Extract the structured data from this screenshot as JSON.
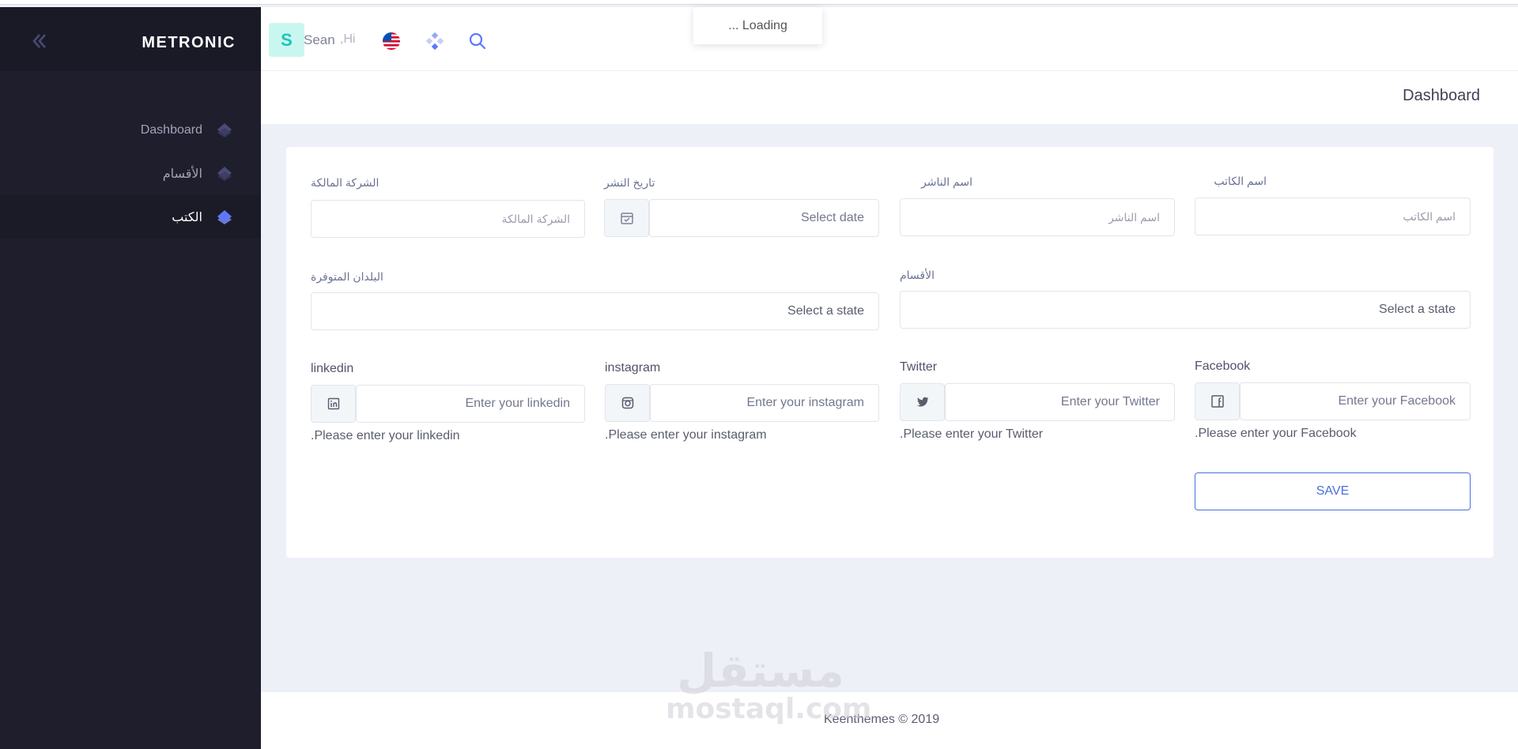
{
  "sidebar": {
    "brand": "METRONIC",
    "items": [
      {
        "label": "Dashboard"
      },
      {
        "label": "الأقسام"
      },
      {
        "label": "الكتب"
      }
    ]
  },
  "header": {
    "avatar_initial": "S",
    "user_name": "Sean",
    "greeting": ",Hi",
    "loading": "... Loading"
  },
  "subheader": {
    "title": "Dashboard"
  },
  "form": {
    "author": {
      "label": "اسم الكاتب",
      "placeholder": "اسم الكاتب"
    },
    "publisher": {
      "label": "اسم الناشر",
      "placeholder": "اسم الناشر"
    },
    "publish_date": {
      "label": "تاريخ النشر",
      "placeholder": "Select date"
    },
    "owner_company": {
      "label": "الشركة المالكة",
      "placeholder": "الشركة المالكة"
    },
    "sections": {
      "label": "الأقسام",
      "placeholder": "Select a state"
    },
    "countries": {
      "label": "البلدان المتوفرة",
      "placeholder": "Select a state"
    },
    "facebook": {
      "label": "Facebook",
      "placeholder": "Enter your Facebook",
      "hint": ".Please enter your Facebook"
    },
    "twitter": {
      "label": "Twitter",
      "placeholder": "Enter your Twitter",
      "hint": ".Please enter your Twitter"
    },
    "instagram": {
      "label": "instagram",
      "placeholder": "Enter your instagram",
      "hint": ".Please enter your instagram"
    },
    "linkedin": {
      "label": "linkedin",
      "placeholder": "Enter your linkedin",
      "hint": ".Please enter your linkedin"
    },
    "save_label": "SAVE"
  },
  "footer": {
    "text": "Keenthemes © 2019"
  },
  "watermark": {
    "arabic": "مستقل",
    "latin": "mostaql.com"
  },
  "colors": {
    "sidebar_bg": "#1e1e2d",
    "primary": "#4a6fe0",
    "avatar_bg": "#c9f7ef",
    "avatar_text": "#1bc5bd"
  }
}
